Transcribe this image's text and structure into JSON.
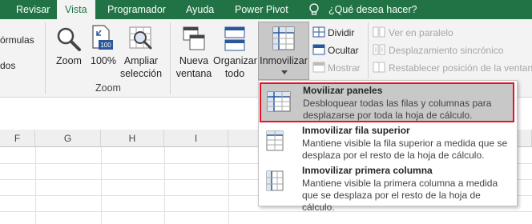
{
  "tabs": {
    "revisar": "Revisar",
    "vista": "Vista",
    "programador": "Programador",
    "ayuda": "Ayuda",
    "power_pivot": "Power Pivot",
    "tell_me": "¿Qué desea hacer?"
  },
  "ribbon": {
    "left_cut_1": "órmulas",
    "left_cut_2": "dos",
    "zoom": "Zoom",
    "zoom100": "100%",
    "ampliar_1": "Ampliar",
    "ampliar_2": "selección",
    "zoom_group": "Zoom",
    "nueva_1": "Nueva",
    "nueva_2": "ventana",
    "organizar_1": "Organizar",
    "organizar_2": "todo",
    "inmovilizar": "Inmovilizar",
    "dividir": "Dividir",
    "ocultar": "Ocultar",
    "mostrar": "Mostrar",
    "paralelo": "Ver en paralelo",
    "sincronico": "Desplazamiento sincrónico",
    "restablecer": "Restablecer posición de la ventana"
  },
  "columns": [
    "F",
    "G",
    "H",
    "I"
  ],
  "menu": {
    "item1_title": "Movilizar paneles",
    "item1_desc": "Desbloquear todas las filas y columnas para desplazarse por toda la hoja de cálculo.",
    "item2_title": "Inmovilizar fila superior",
    "item2_desc": "Mantiene visible la fila superior a medida que se desplaza por el resto de la hoja de cálculo.",
    "item3_title": "Inmovilizar primera columna",
    "item3_desc": "Mantiene visible la primera columna a medida que se desplaza por el resto de la hoja de cálculo."
  },
  "colors": {
    "excel_green": "#217346",
    "highlight": "#c8c8c8",
    "red_box": "#e81123"
  }
}
